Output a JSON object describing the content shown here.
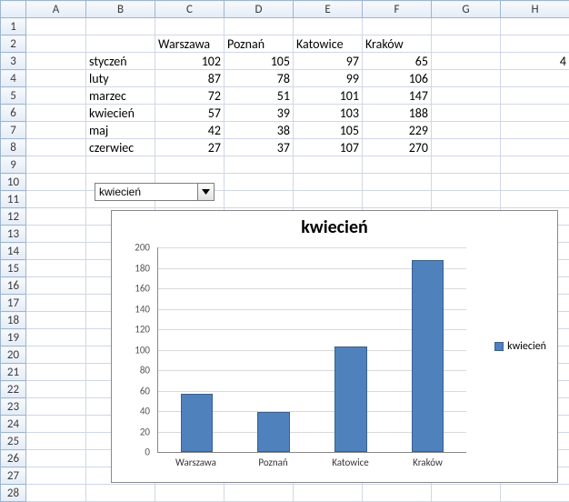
{
  "columns": [
    "A",
    "B",
    "C",
    "D",
    "E",
    "F",
    "G",
    "H"
  ],
  "row_count": 28,
  "header_row": {
    "C2": "Warszawa",
    "D2": "Poznań",
    "E2": "Katowice",
    "F2": "Kraków"
  },
  "months_col": {
    "B3": "styczeń",
    "B4": "luty",
    "B5": "marzec",
    "B6": "kwiecień",
    "B7": "maj",
    "B8": "czerwiec"
  },
  "data_cells": {
    "C3": 102,
    "D3": 105,
    "E3": 97,
    "F3": 65,
    "C4": 87,
    "D4": 78,
    "E4": 99,
    "F4": 106,
    "C5": 72,
    "D5": 51,
    "E5": 101,
    "F5": 147,
    "C6": 57,
    "D6": 39,
    "E6": 103,
    "F6": 188,
    "C7": 42,
    "D7": 38,
    "E7": 105,
    "F7": 229,
    "C8": 27,
    "D8": 37,
    "E8": 107,
    "F8": 270
  },
  "extra_cells": {
    "H3": 4
  },
  "combo": {
    "value": "kwiecień"
  },
  "chart_data": {
    "type": "bar",
    "title": "kwiecień",
    "categories": [
      "Warszawa",
      "Poznań",
      "Katowice",
      "Kraków"
    ],
    "values": [
      57,
      39,
      103,
      188
    ],
    "series_name": "kwiecień",
    "ylim": [
      0,
      200
    ],
    "ytick_step": 20,
    "xlabel": "",
    "ylabel": "",
    "legend_position": "right",
    "grid": true,
    "bar_color": "#4f81bd"
  }
}
